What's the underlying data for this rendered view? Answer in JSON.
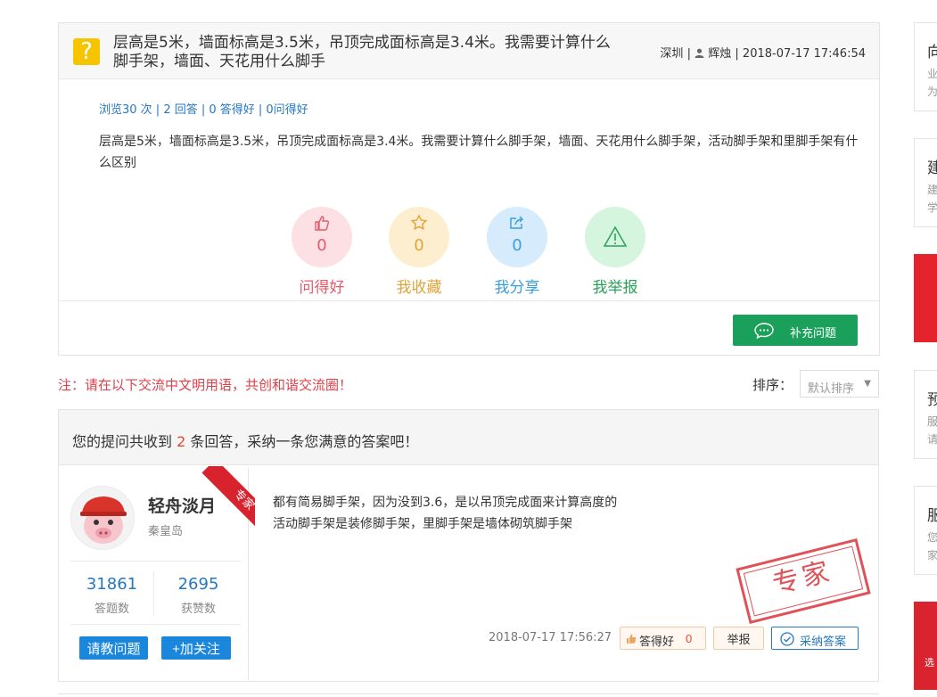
{
  "question": {
    "title": "层高是5米，墙面标高是3.5米，吊顶完成面标高是3.4米。我需要计算什么脚手架，墙面、天花用什么脚手",
    "city": "深圳",
    "sep1": "|",
    "author": "辉烛",
    "sep2": "|",
    "time": "2018-07-17 17:46:54",
    "stats": "浏览30 次 | 2 回答 | 0 答得好 | 0问得好",
    "body": "层高是5米，墙面标高是3.5米，吊顶完成面标高是3.4米。我需要计算什么脚手架，墙面、天花用什么脚手架，活动脚手架和里脚手架有什么区别",
    "actions": [
      {
        "count": "0",
        "label": "问得好",
        "icon": "thumb-up-icon",
        "color": "#e85a6b",
        "bg": "#fde0e4"
      },
      {
        "count": "0",
        "label": "我收藏",
        "icon": "star-icon",
        "color": "#e0a43a",
        "bg": "#fdeecf"
      },
      {
        "count": "0",
        "label": "我分享",
        "icon": "share-icon",
        "color": "#3a9de0",
        "bg": "#d6ecfc"
      },
      {
        "count": "",
        "label": "我举报",
        "icon": "warning-icon",
        "color": "#2aa35a",
        "bg": "#d6f5df"
      }
    ],
    "supplement_button": "补充问题"
  },
  "notice": "注：请在以下交流中文明用语，共创和谐交流圈！",
  "sort": {
    "label": "排序：",
    "selected": "默认排序"
  },
  "answers_header": {
    "prefix": "您的提问共收到",
    "count": "2",
    "suffix": "条回答，采纳一条您满意的答案吧！"
  },
  "answer": {
    "user_name": "轻舟淡月",
    "user_city": "秦皇岛",
    "badge": "专家",
    "answers_count": "31861",
    "answers_label": "答题数",
    "likes_count": "2695",
    "likes_label": "获赞数",
    "ask_button": "请教问题",
    "follow_button": "+加关注",
    "text_line1": "都有简易脚手架，因为没到3.6，是以吊顶完成面来计算高度的",
    "text_line2": "活动脚手架是装修脚手架，里脚手架是墙体砌筑脚手架",
    "stamp": "专家",
    "time": "2018-07-17 17:56:27",
    "good_label": "答得好",
    "good_count": "0",
    "report_label": "举报",
    "adopt_label": "采纳答案"
  },
  "sidebar": [
    {
      "t": "向",
      "s1": "业",
      "s2": "为"
    },
    {
      "t": "建",
      "s1": "建",
      "s2": "学"
    },
    {
      "t": "预",
      "s1": "服",
      "s2": "请"
    },
    {
      "t": "服",
      "s1": "您",
      "s2": "家"
    }
  ],
  "ad_bottom_text": "选"
}
